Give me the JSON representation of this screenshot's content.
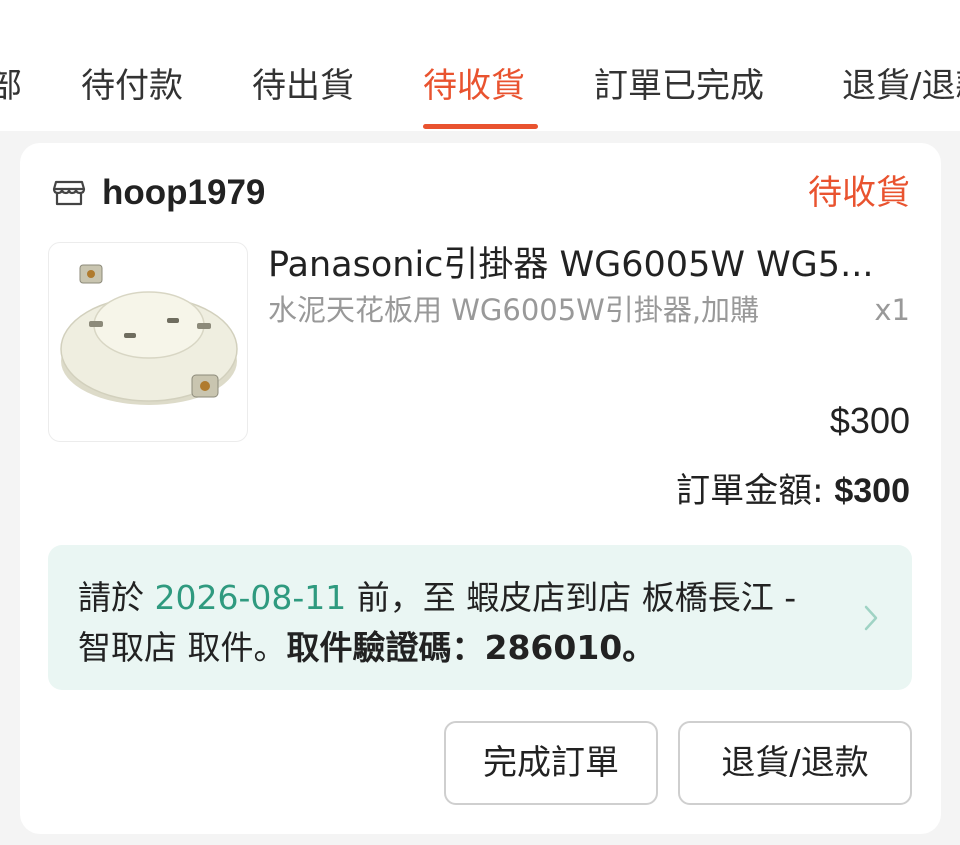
{
  "tabs": [
    {
      "label": "全部",
      "active": false
    },
    {
      "label": "待付款",
      "active": false
    },
    {
      "label": "待出貨",
      "active": false
    },
    {
      "label": "待收貨",
      "active": true
    },
    {
      "label": "訂單已完成",
      "active": false
    },
    {
      "label": "退貨/退款",
      "active": false
    }
  ],
  "order": {
    "shop_icon": "store-icon",
    "shop_name": "hoop1979",
    "status": "待收貨",
    "product": {
      "name": "Panasonic引掛器 WG6005W WG5...",
      "variant": "水泥天花板用 WG6005W引掛器,加購",
      "quantity": "x1",
      "price": "$300"
    },
    "total_label": "訂單金額: ",
    "total_amount": "$300",
    "pickup": {
      "prefix": "請於 ",
      "date": "2026-08-11",
      "middle": " 前，至 蝦皮店到店 板橋長江 - 智取店 取件。",
      "code_text": "取件驗證碼：286010。",
      "chevron_icon": "chevron-right-icon"
    },
    "buttons": {
      "complete": "完成訂單",
      "return": "退貨/退款"
    }
  },
  "colors": {
    "accent": "#e9532f",
    "pickup_bg": "#eaf6f3",
    "pickup_date": "#2f9a7f"
  }
}
